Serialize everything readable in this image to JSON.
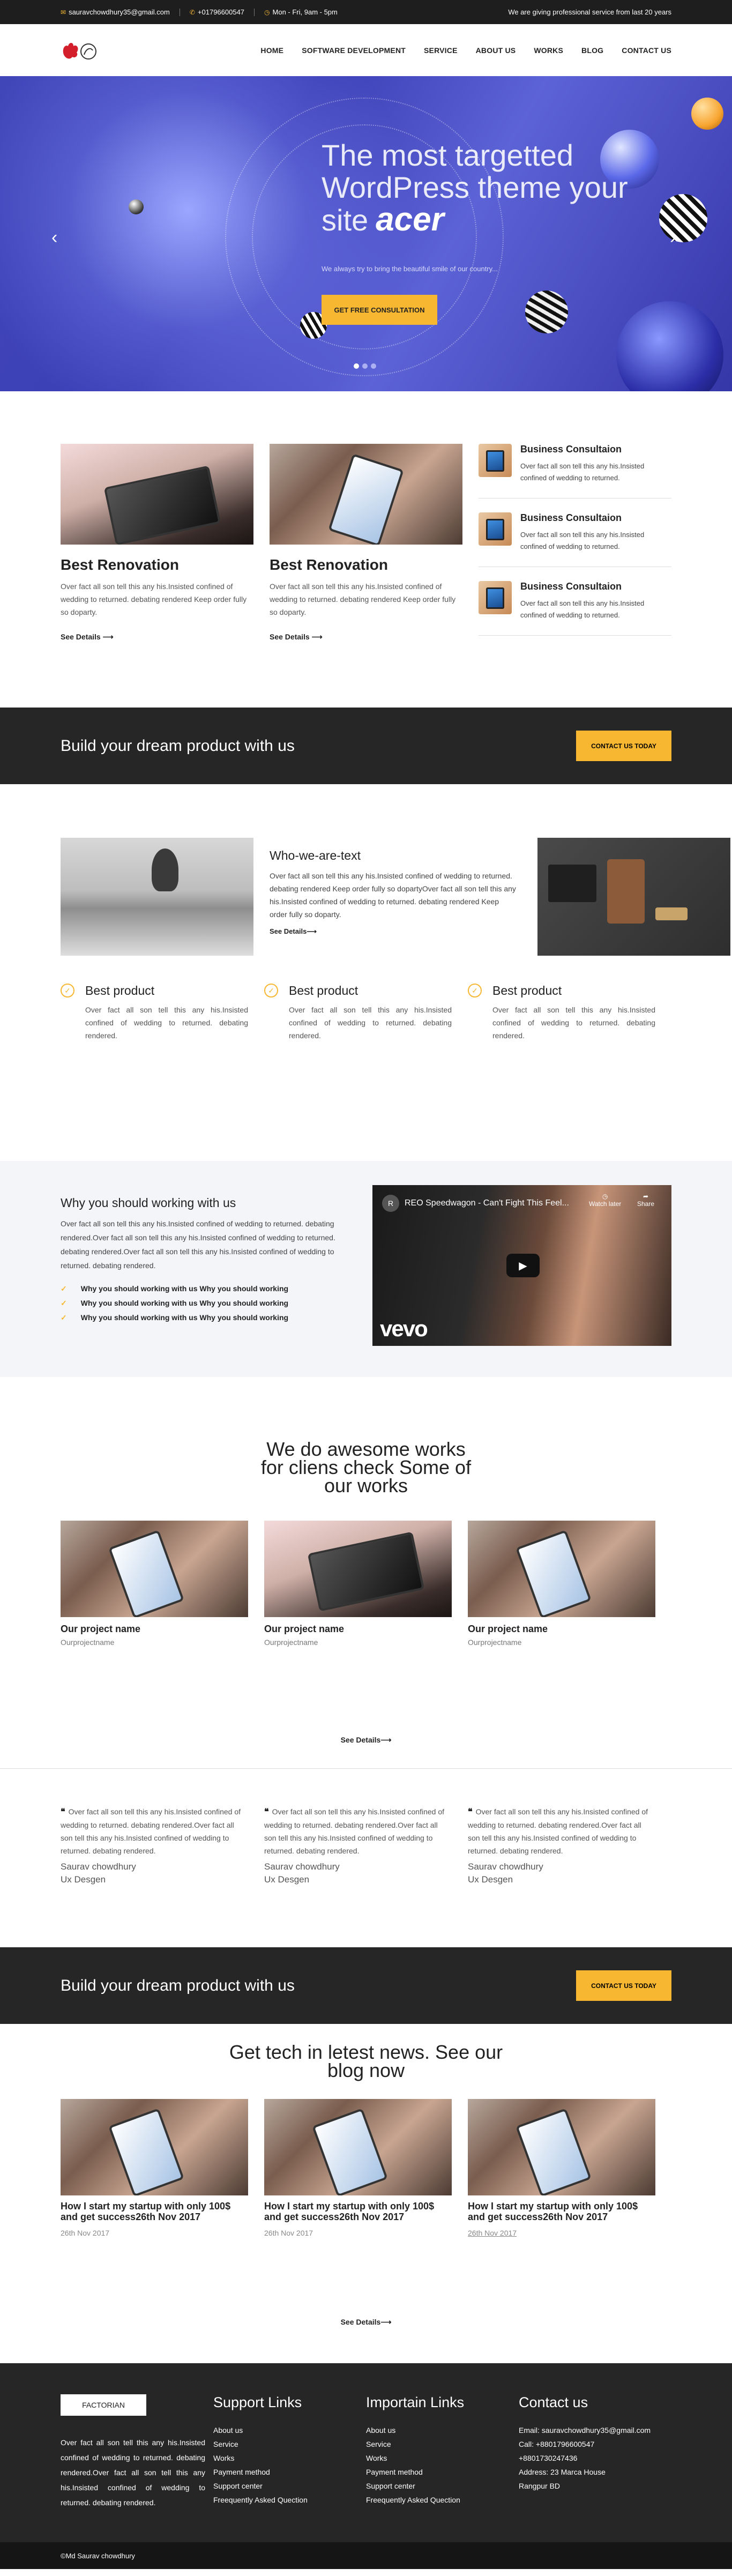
{
  "topbar": {
    "email": "sauravchowdhury35@gmail.com",
    "phone": "+01796600547",
    "hours": "Mon - Fri, 9am - 5pm",
    "tagline": "We are giving professional service from last 20 years"
  },
  "nav": [
    "HOME",
    "SOFTWARE DEVELOPMENT",
    "SERVICE",
    "ABOUT US",
    "WORKS",
    "BLOG",
    "CONTACT US"
  ],
  "hero": {
    "title": "The most targetted WordPress theme your site",
    "brand": "acer",
    "subtitle": "We always try to bring the beautiful smile of our country...",
    "button": "GET FREE CONSULTATION",
    "prev_icon": "chevron-left-icon",
    "next_icon": "chevron-right-icon"
  },
  "features": {
    "cards": [
      {
        "title": "Best Renovation",
        "text": "Over fact all son tell this any his.Insisted confined of wedding to returned. debating rendered Keep order fully so doparty.",
        "more": "See Details"
      },
      {
        "title": "Best Renovation",
        "text": "Over fact all son tell this any his.Insisted confined of wedding to returned. debating rendered Keep order fully so doparty.",
        "more": "See Details"
      }
    ],
    "consult": [
      {
        "title": "Business Consultaion",
        "text": "Over fact all son tell this any his.Insisted confined of wedding to returned."
      },
      {
        "title": "Business Consultaion",
        "text": "Over fact all son tell this any his.Insisted confined of wedding to returned."
      },
      {
        "title": "Business Consultaion",
        "text": "Over fact all son tell this any his.Insisted confined of wedding to returned."
      }
    ]
  },
  "cta": {
    "title": "Build your dream product with us",
    "button": "CONTACT US TODAY"
  },
  "who": {
    "title": "Who-we-are-text",
    "text": "Over fact all son tell this any his.Insisted confined of wedding to returned. debating rendered Keep order fully so dopartyOver fact all son tell this any his.Insisted confined of wedding to returned. debating rendered Keep order fully so doparty.",
    "more": "See Details",
    "products": [
      {
        "title": "Best product",
        "text": "Over fact all son tell this any his.Insisted confined of wedding to returned. debating rendered."
      },
      {
        "title": "Best product",
        "text": "Over fact all son tell this any his.Insisted confined of wedding to returned. debating rendered."
      },
      {
        "title": "Best product",
        "text": "Over fact all son tell this any his.Insisted confined of wedding to returned. debating rendered."
      }
    ]
  },
  "why": {
    "title": "Why you should working with us",
    "text": "Over fact all son tell this any his.Insisted confined of wedding to returned. debating rendered.Over fact all son tell this any his.Insisted confined of wedding to returned. debating rendered.Over fact all son tell this any his.Insisted confined of wedding to returned. debating rendered.",
    "items": [
      "Why you should working with us Why you should working",
      "Why you should working with us Why you should working",
      "Why you should working with us Why you should working"
    ],
    "video": {
      "title": "REO Speedwagon - Can't Fight This Feel...",
      "channel_initial": "R",
      "watch_later": "Watch later",
      "share": "Share",
      "brand": "vevo"
    }
  },
  "works": {
    "title": "We do awesome works for cliens check Some of our works",
    "items": [
      {
        "name": "Our project name",
        "sub": "Ourprojectname"
      },
      {
        "name": "Our project name",
        "sub": "Ourprojectname"
      },
      {
        "name": "Our project name",
        "sub": "Ourprojectname"
      }
    ],
    "more": "See Details"
  },
  "testimonials": [
    {
      "text": "Over fact all son tell this any his.Insisted confined of wedding to returned. debating rendered.Over fact all son tell this any his.Insisted confined of wedding to returned. debating rendered.",
      "name": "Saurav chowdhury",
      "role": "Ux Desgen"
    },
    {
      "text": "Over fact all son tell this any his.Insisted confined of wedding to returned. debating rendered.Over fact all son tell this any his.Insisted confined of wedding to returned. debating rendered.",
      "name": "Saurav chowdhury",
      "role": "Ux Desgen"
    },
    {
      "text": "Over fact all son tell this any his.Insisted confined of wedding to returned. debating rendered.Over fact all son tell this any his.Insisted confined of wedding to returned. debating rendered.",
      "name": "Saurav chowdhury",
      "role": "Ux Desgen"
    }
  ],
  "cta2": {
    "title": "Build your dream product with us",
    "button": "CONTACT US TODAY"
  },
  "blog": {
    "title": "Get tech in letest news. See our blog now",
    "posts": [
      {
        "title": "How I start my startup with only 100$ and get success26th Nov 2017",
        "date": "26th Nov 2017"
      },
      {
        "title": "How I start my startup with only 100$ and get success26th Nov 2017",
        "date": "26th Nov 2017"
      },
      {
        "title": "How I start my startup with only 100$ and get success26th Nov 2017",
        "date": "26th Nov 2017"
      }
    ],
    "more": "See Details"
  },
  "footer": {
    "brand": "FACTORIAN",
    "desc": "Over fact all son tell this any his.Insisted confined of wedding to returned. debating rendered.Over fact all son tell this any his.Insisted confined of wedding to returned. debating rendered.",
    "support_title": "Support Links",
    "support": [
      "About us",
      "Service",
      "Works",
      "Payment method",
      "Support center",
      "Freequently Asked Quection"
    ],
    "important_title": "Importain Links",
    "important": [
      "About us",
      "Service",
      "Works",
      "Payment method",
      "Support center",
      "Freequently Asked Quection"
    ],
    "contact_title": "Contact us",
    "contact": [
      "Email: sauravchowdhury35@gmail.com",
      "Call: +8801796600547",
      "+8801730247436",
      "Address: 23 Marca House",
      "Rangpur BD"
    ]
  },
  "copyright": "©Md Saurav chowdhury",
  "colors": {
    "accent": "#f8b731",
    "dark": "#262626",
    "hero": "#3b3fb5"
  }
}
